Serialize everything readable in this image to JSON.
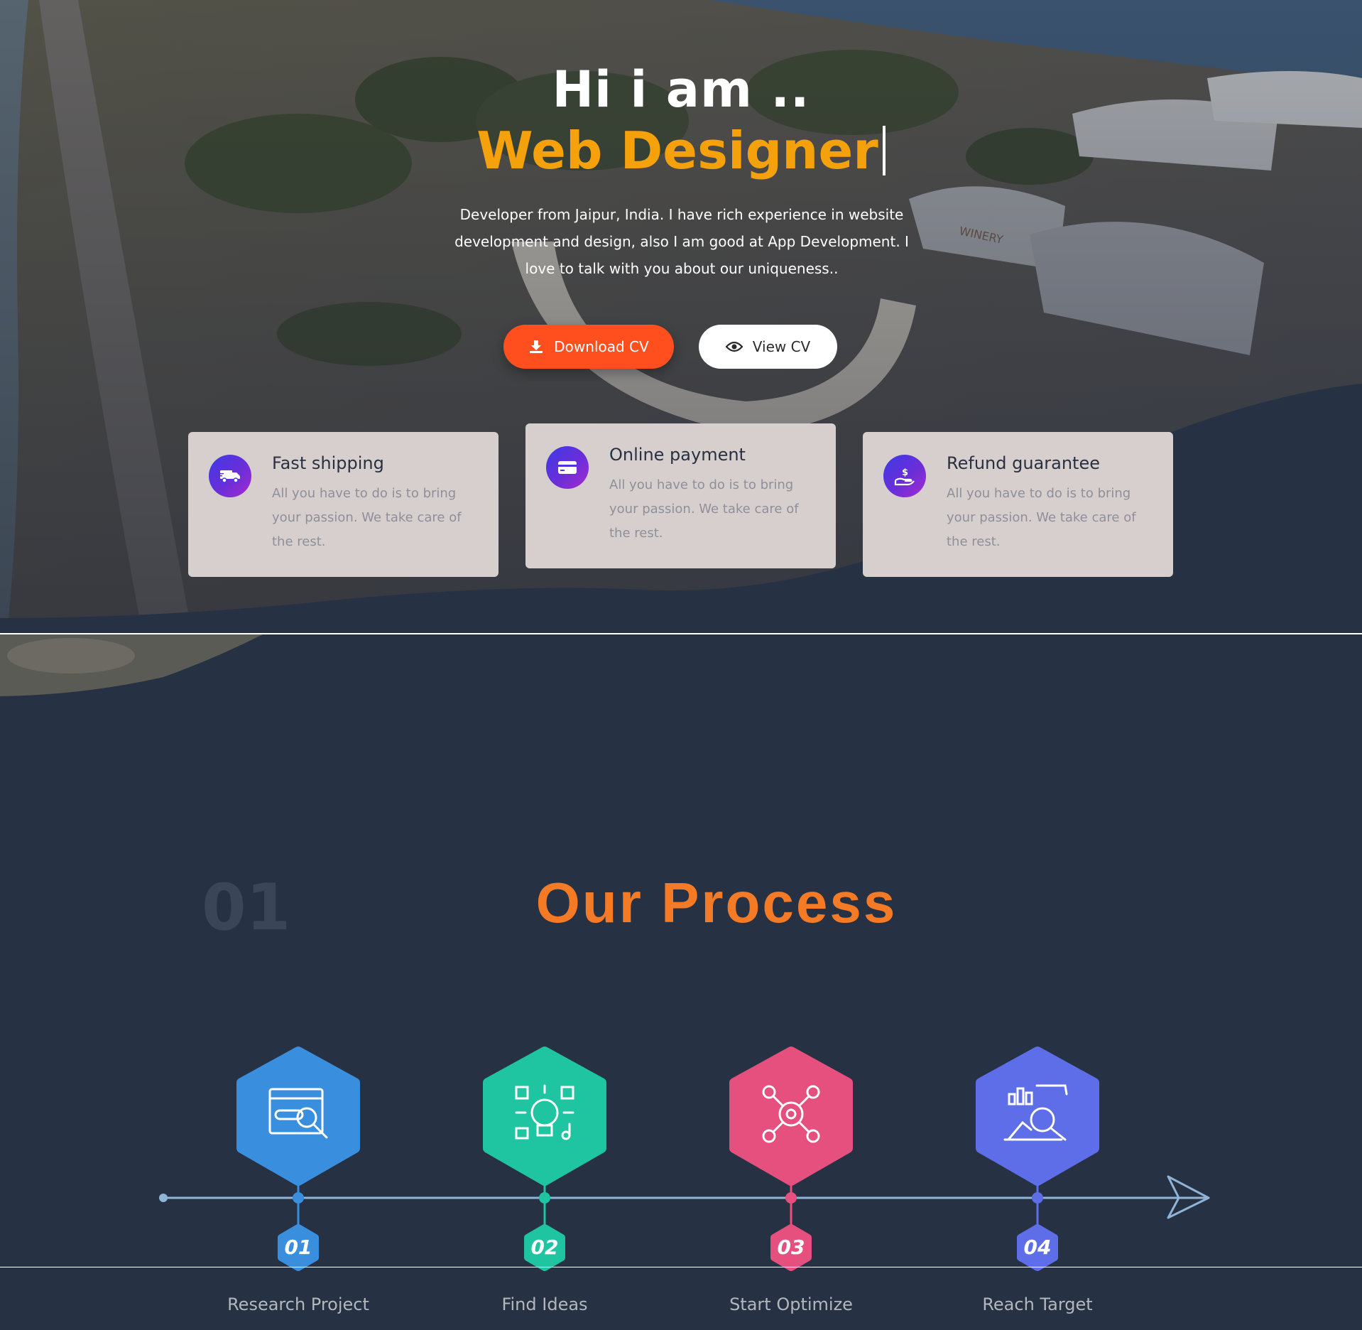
{
  "hero": {
    "greeting": "Hi i am ..",
    "role": "Web Designer",
    "description": "Developer from Jaipur, India. I have rich experience in website development and design, also I am good at App Development. I love to talk with you about our uniqueness..",
    "download_label": "Download CV",
    "view_label": "View CV",
    "overlay_text": "WINERY"
  },
  "features": [
    {
      "title": "Fast shipping",
      "text": "All you have to do is to bring your passion. We take care of the rest.",
      "icon": "truck-icon"
    },
    {
      "title": "Online payment",
      "text": "All you have to do is to bring your passion. We take care of the rest.",
      "icon": "credit-card-icon"
    },
    {
      "title": "Refund guarantee",
      "text": "All you have to do is to bring your passion. We take care of the rest.",
      "icon": "dollar-hand-icon"
    }
  ],
  "process": {
    "section_number": "01",
    "title": "Our Process",
    "steps": [
      {
        "num": "01",
        "label": "Research Project",
        "color": "#3a8ede",
        "icon": "browser-search-icon"
      },
      {
        "num": "02",
        "label": "Find Ideas",
        "color": "#1fc4a0",
        "icon": "lightbulb-ideas-icon"
      },
      {
        "num": "03",
        "label": "Start Optimize",
        "color": "#e6507e",
        "icon": "gear-network-icon"
      },
      {
        "num": "04",
        "label": "Reach Target",
        "color": "#5d6ee8",
        "icon": "analytics-search-icon"
      }
    ]
  },
  "colors": {
    "background": "#263243",
    "accent_orange": "#f5a10c",
    "download_button": "#ff4f1f",
    "process_title": "#f57a25",
    "card_background": "#d6cfce",
    "timeline_line": "#8fb4d8"
  }
}
